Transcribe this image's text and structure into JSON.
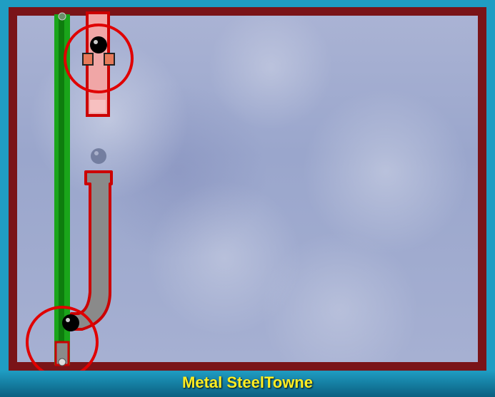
{
  "level": {
    "title": "Metal SteelTowne"
  },
  "colors": {
    "frame": "#1f9dc3",
    "border": "#7a1418",
    "rail": "#19a319",
    "pipe_outline": "#cc0000",
    "pipe_fill_gray": "#8a8a8a",
    "pipe_fill_pink": "#f0a0a0",
    "circle_ring": "#e00000",
    "ball": "#000000",
    "title_text": "#ffee22"
  },
  "objects": {
    "green_rail": "green-rail",
    "upper_pipe": "upper-pipe",
    "lower_pipe": "lower-pipe",
    "upper_ball": "ball",
    "lower_ball": "ball",
    "ghost_ball": "ghost-ball"
  }
}
